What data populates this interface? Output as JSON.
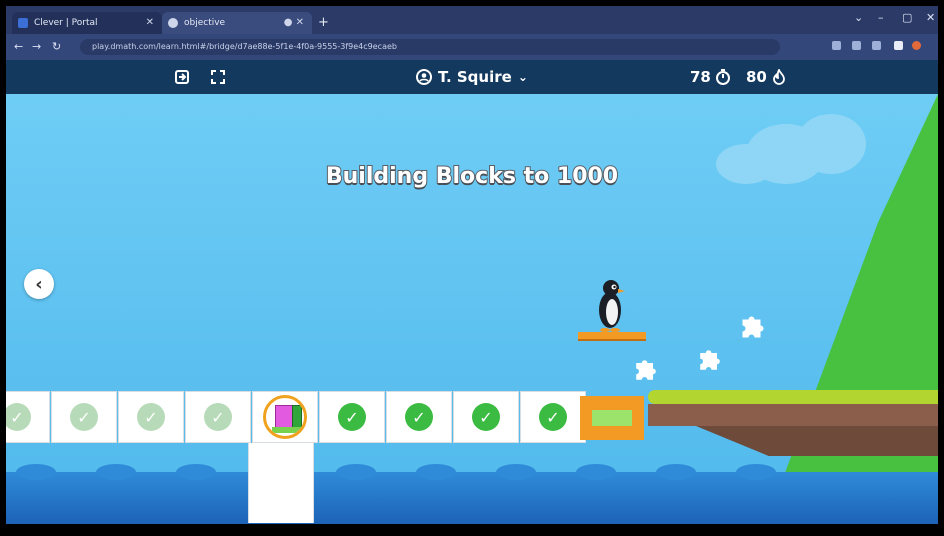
{
  "browser": {
    "tabs": [
      {
        "label": "Clever | Portal",
        "active": false
      },
      {
        "label": "objective",
        "active": true
      }
    ],
    "url": "play.dmath.com/learn.html#/bridge/d7ae88e-5f1e-4f0a-9555-3f9e4c9ecaeb"
  },
  "header": {
    "user_name": "T. Squire",
    "timer_value": "78",
    "score_value": "80"
  },
  "game": {
    "title": "Building Blocks to 1000",
    "track": [
      {
        "state": "faded"
      },
      {
        "state": "faded"
      },
      {
        "state": "faded"
      },
      {
        "state": "faded"
      },
      {
        "state": "current"
      },
      {
        "state": "done"
      },
      {
        "state": "done"
      },
      {
        "state": "done"
      },
      {
        "state": "done"
      }
    ],
    "colors": {
      "sky": "#5ec3f1",
      "orange": "#f39a24",
      "check_green": "#3cbb43",
      "mountain": "#47c13f"
    }
  },
  "icons": [
    "exit-icon",
    "fullscreen-icon",
    "user-icon",
    "chevron-down-icon",
    "timer-icon",
    "flame-icon",
    "back-chevron-icon",
    "check-icon",
    "puzzle-piece-icon",
    "penguin"
  ]
}
